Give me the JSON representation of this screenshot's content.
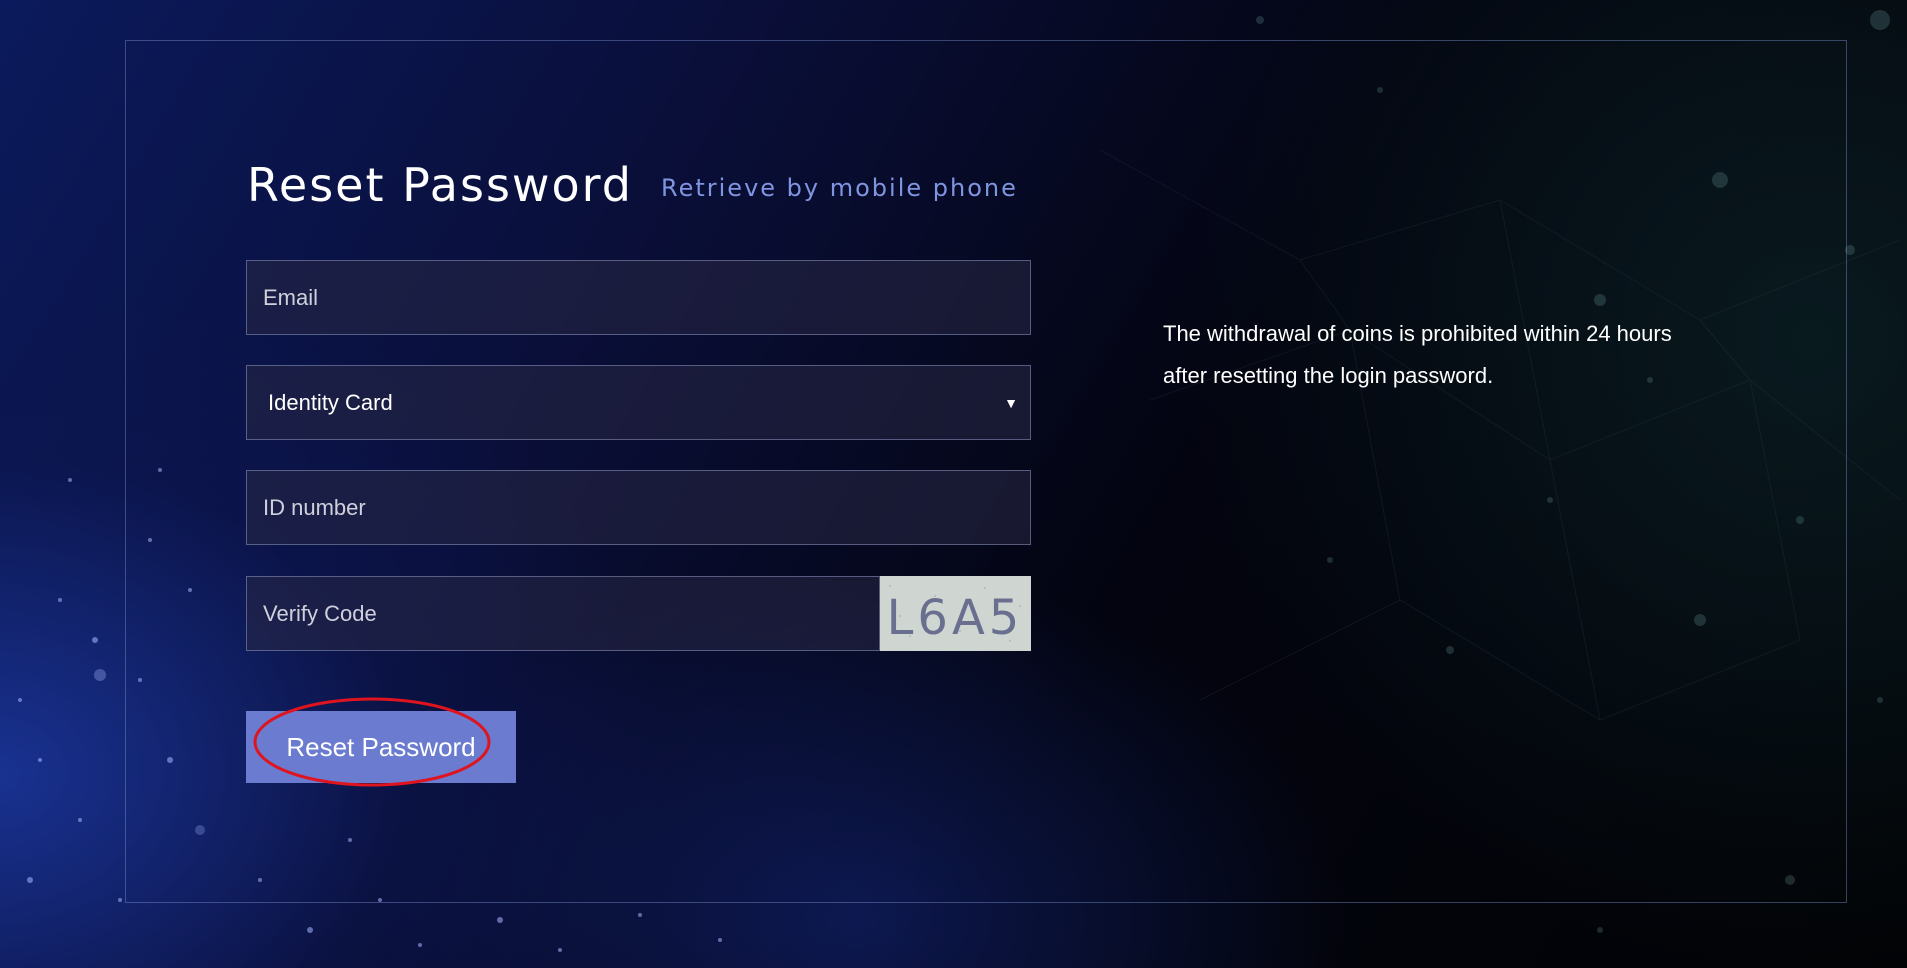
{
  "header": {
    "title": "Reset Password",
    "alt_method_link": "Retrieve by mobile phone"
  },
  "form": {
    "email_placeholder": "Email",
    "id_type_selected": "Identity Card",
    "id_number_placeholder": "ID number",
    "verify_code_placeholder": "Verify Code",
    "captcha_text": "L6A5",
    "submit_label": "Reset Password"
  },
  "notice": {
    "line1": "The withdrawal of coins is prohibited within 24 hours",
    "line2": "after resetting the login password."
  },
  "colors": {
    "accent": "#6a7bd0",
    "link": "#7f95e0",
    "highlight_annotation": "#e0141e"
  }
}
